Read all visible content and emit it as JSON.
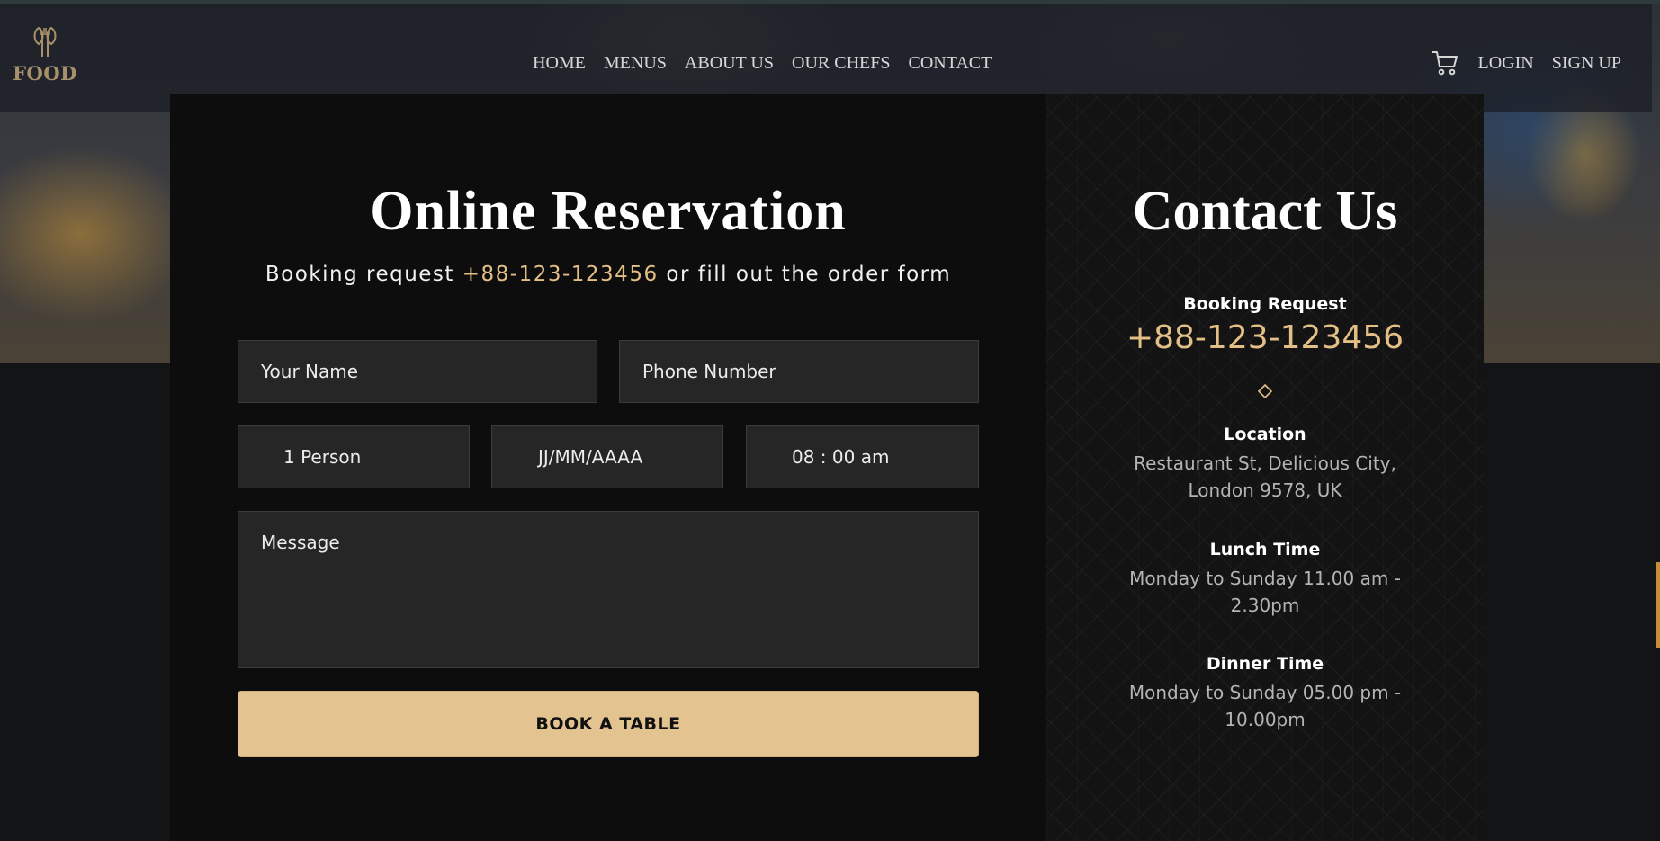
{
  "brand": {
    "name": "FOOD",
    "logo_icon": "fork-spoon-icon"
  },
  "nav": [
    {
      "label": "HOME"
    },
    {
      "label": "MENUS"
    },
    {
      "label": "ABOUT US"
    },
    {
      "label": "OUR CHEFS"
    },
    {
      "label": "CONTACT"
    }
  ],
  "auth": {
    "cart_icon": "cart-icon",
    "login": "LOGIN",
    "signup": "SIGN UP"
  },
  "reservation": {
    "title": "Online Reservation",
    "subtitle_before": "Booking request ",
    "subtitle_phone": "+88-123-123456",
    "subtitle_after": " or fill out the order form",
    "fields": {
      "name_placeholder": "Your Name",
      "phone_placeholder": "Phone Number",
      "persons_value": "1 Person",
      "date_value": "JJ/MM/AAAA",
      "time_value": "08 : 00 am",
      "message_placeholder": "Message"
    },
    "submit_label": "BOOK A TABLE"
  },
  "contact": {
    "title": "Contact Us",
    "booking_label": "Booking Request",
    "booking_phone": "+88-123-123456",
    "location_label": "Location",
    "location_line1": "Restaurant St, Delicious City,",
    "location_line2": "London 9578, UK",
    "lunch_label": "Lunch Time",
    "lunch_line1": "Monday to Sunday 11.00 am -",
    "lunch_line2": "2.30pm",
    "dinner_label": "Dinner Time",
    "dinner_line1": "Monday to Sunday 05.00 pm -",
    "dinner_line2": "10.00pm"
  },
  "colors": {
    "accent": "#e3c390",
    "phone_accent": "#e3bf86",
    "panel": "#0d0d0d",
    "field": "#262626"
  }
}
